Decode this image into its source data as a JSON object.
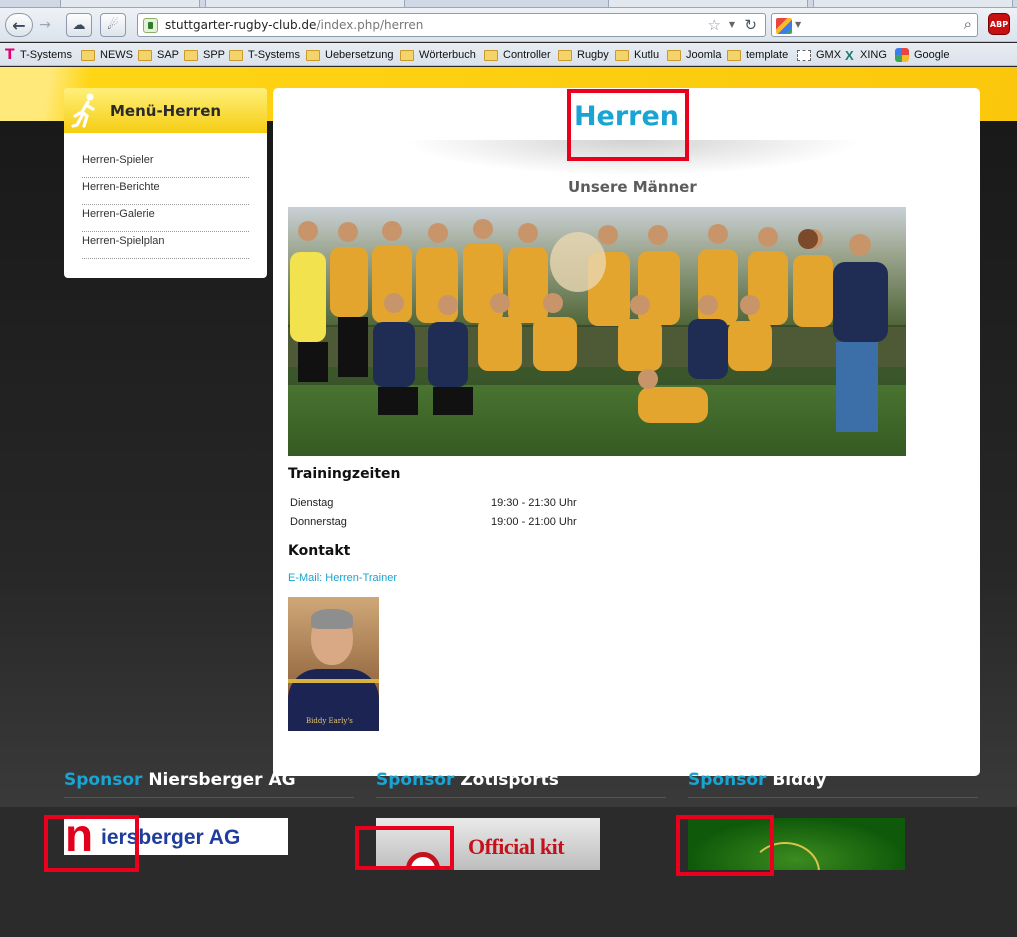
{
  "browser": {
    "url_domain": "stuttgarter-rugby-club.de",
    "url_path": "/index.php/herren",
    "bookmarks": [
      {
        "label": "T-Systems",
        "icon": "tsystems-icon"
      },
      {
        "label": "NEWS",
        "icon": "folder-icon"
      },
      {
        "label": "SAP",
        "icon": "folder-icon"
      },
      {
        "label": "SPP",
        "icon": "folder-icon"
      },
      {
        "label": "T-Systems",
        "icon": "folder-icon"
      },
      {
        "label": "Uebersetzung",
        "icon": "folder-icon"
      },
      {
        "label": "Wörterbuch",
        "icon": "folder-icon"
      },
      {
        "label": "Controller",
        "icon": "folder-icon"
      },
      {
        "label": "Rugby",
        "icon": "folder-icon"
      },
      {
        "label": "Kutlu",
        "icon": "folder-icon"
      },
      {
        "label": "Joomla",
        "icon": "folder-icon"
      },
      {
        "label": "template",
        "icon": "folder-icon"
      },
      {
        "label": "GMX",
        "icon": "gmx-icon"
      },
      {
        "label": "XING",
        "icon": "xing-icon"
      },
      {
        "label": "Google",
        "icon": "google-icon"
      }
    ],
    "abp_label": "ABP"
  },
  "sidebar": {
    "title": "Menü-Herren",
    "items": [
      {
        "label": "Herren-Spieler"
      },
      {
        "label": "Herren-Berichte"
      },
      {
        "label": "Herren-Galerie"
      },
      {
        "label": "Herren-Spielplan"
      }
    ]
  },
  "content": {
    "title": "Herren",
    "subtitle": "Unsere Männer",
    "training_heading": "Trainingzeiten",
    "training": [
      {
        "day": "Dienstag",
        "time": "19:30 - 21:30 Uhr"
      },
      {
        "day": "Donnerstag",
        "time": "19:00 - 21:00 Uhr"
      }
    ],
    "contact_heading": "Kontakt",
    "contact_link": "E-Mail: Herren-Trainer",
    "trainer_caption": "Biddy Early's"
  },
  "sponsors": [
    {
      "prefix": "Sponsor",
      "name": "Niersberger AG",
      "logo_initial": "n",
      "logo_text": "iersberger AG"
    },
    {
      "prefix": "Sponsor",
      "name": "Zotisports",
      "logo_text": "Official kit"
    },
    {
      "prefix": "Sponsor",
      "name": "Biddy"
    }
  ],
  "colors": {
    "accent_blue": "#1aa4d3",
    "header_yellow": "#fbc70c",
    "highlight_red": "#e8001c"
  }
}
